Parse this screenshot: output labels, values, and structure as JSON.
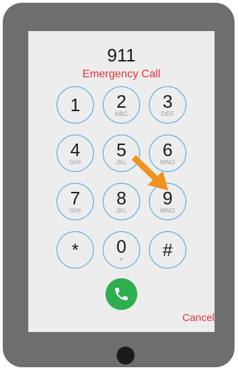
{
  "dialer": {
    "number": "911",
    "subtitle": "Emergency Call",
    "keys": [
      {
        "digit": "1",
        "letters": ""
      },
      {
        "digit": "2",
        "letters": "ABC"
      },
      {
        "digit": "3",
        "letters": "DEF"
      },
      {
        "digit": "4",
        "letters": "GHI"
      },
      {
        "digit": "5",
        "letters": "JKL"
      },
      {
        "digit": "6",
        "letters": "MNO"
      },
      {
        "digit": "7",
        "letters": "GHI"
      },
      {
        "digit": "8",
        "letters": "JKL"
      },
      {
        "digit": "9",
        "letters": "MNO"
      },
      {
        "digit": "*",
        "letters": ""
      },
      {
        "digit": "0",
        "letters": "+"
      },
      {
        "digit": "#",
        "letters": ""
      }
    ],
    "call_icon": "phone-icon",
    "cancel_label": "Cancel"
  },
  "annotation": {
    "arrow_icon": "arrow-icon",
    "arrow_color": "#f0921e"
  },
  "colors": {
    "key_border": "#37a6de",
    "emergency_red": "#e2323a",
    "call_green": "#2fae4f",
    "device_frame": "#6e6e70"
  }
}
